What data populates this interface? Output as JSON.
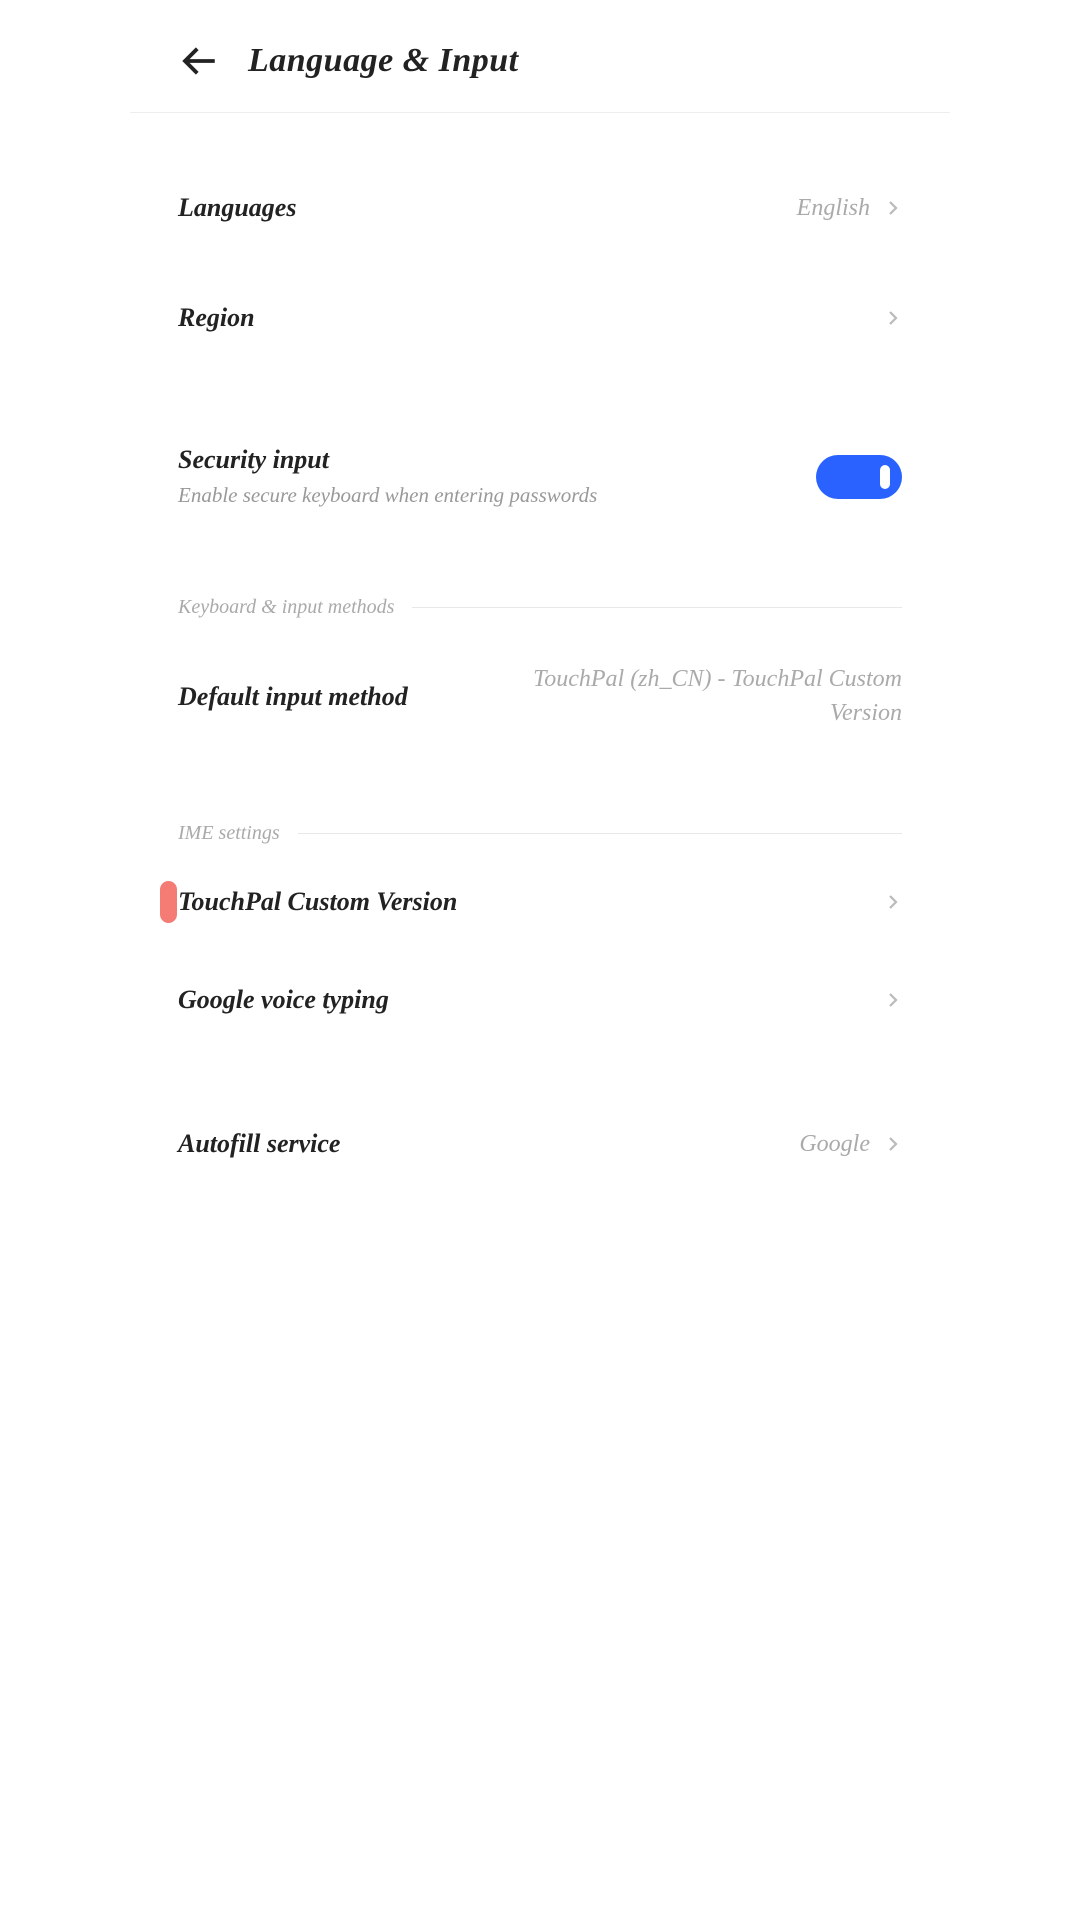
{
  "header": {
    "title": "Language & Input"
  },
  "rows": {
    "languages": {
      "label": "Languages",
      "value": "English"
    },
    "region": {
      "label": "Region"
    },
    "securityInput": {
      "label": "Security input",
      "sub": "Enable secure keyboard when entering passwords"
    },
    "defaultInput": {
      "label": "Default input method",
      "value": "TouchPal (zh_CN) - TouchPal Custom Version"
    },
    "touchpal": {
      "label": "TouchPal Custom Version"
    },
    "googleVoice": {
      "label": "Google voice typing"
    },
    "autofill": {
      "label": "Autofill service",
      "value": "Google"
    }
  },
  "sections": {
    "keyboard": "Keyboard & input methods",
    "ime": "IME settings"
  }
}
